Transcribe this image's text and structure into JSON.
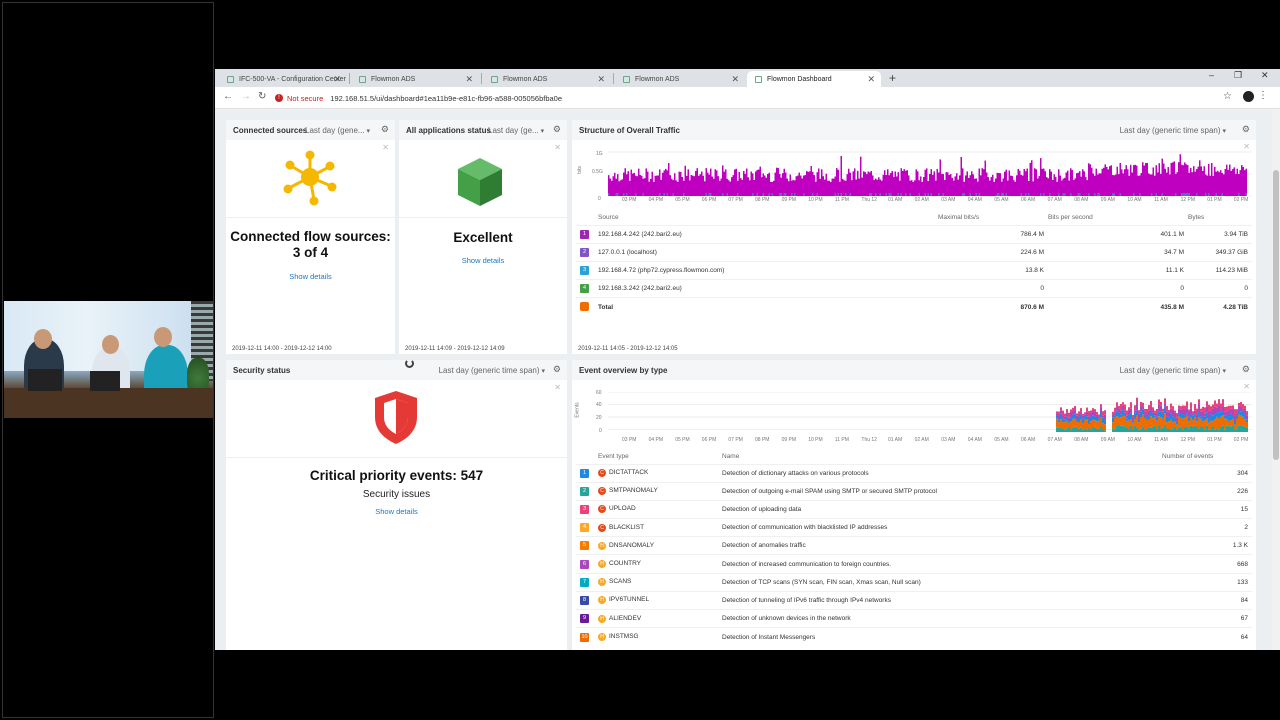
{
  "browser": {
    "tabs": [
      {
        "label": "IFC-500-VA - Configuration Center"
      },
      {
        "label": "Flowmon ADS"
      },
      {
        "label": "Flowmon ADS"
      },
      {
        "label": "Flowmon ADS"
      },
      {
        "label": "Flowmon Dashboard"
      }
    ],
    "new_tab": "+",
    "minimize": "–",
    "maximize": "❐",
    "close": "✕",
    "not_secure": "Not secure",
    "url": "192.168.51.5/ui/dashboard#1ea11b9e-e81c-fb96-a588-005056bfba0e"
  },
  "widgets": {
    "connected_sources": {
      "title": "Connected sources",
      "span": "Last day (gene...",
      "main": "Connected flow sources: 3 of 4",
      "link": "Show details",
      "footer": "2019-12-11 14:00 - 2019-12-12 14:00"
    },
    "app_status": {
      "title": "All applications status",
      "span": "Last day (ge...",
      "main": "Excellent",
      "link": "Show details",
      "footer": "2019-12-11 14:09 - 2019-12-12 14:09"
    },
    "security": {
      "title": "Security status",
      "span": "Last day (generic time span)",
      "main": "Critical priority events: 547",
      "sub": "Security issues",
      "link": "Show details"
    },
    "traffic": {
      "title": "Structure of Overall Traffic",
      "span": "Last day (generic time span)",
      "ylabel": "bits",
      "yticks": [
        "1G",
        "0.5G",
        "0"
      ],
      "xticks": [
        "03 PM",
        "04 PM",
        "05 PM",
        "06 PM",
        "07 PM",
        "08 PM",
        "09 PM",
        "10 PM",
        "11 PM",
        "Thu 12",
        "01 AM",
        "02 AM",
        "03 AM",
        "04 AM",
        "05 AM",
        "06 AM",
        "07 AM",
        "08 AM",
        "09 AM",
        "10 AM",
        "11 AM",
        "12 PM",
        "01 PM",
        "02 PM"
      ],
      "columns": [
        "Source",
        "Maximal bits/s",
        "Bits per second",
        "Bytes"
      ],
      "rows": [
        {
          "rank": "1",
          "color": "#9c27b0",
          "source": "192.168.4.242 (242.bari2.eu)",
          "max": "786.4 M",
          "bps": "401.1 M",
          "bytes": "3.94 TiB"
        },
        {
          "rank": "2",
          "color": "#7e57c2",
          "source": "127.0.0.1 (localhost)",
          "max": "224.6 M",
          "bps": "34.7 M",
          "bytes": "349.37 GiB"
        },
        {
          "rank": "3",
          "color": "#29a3d6",
          "source": "192.168.4.72 (php72.cypress.flowmon.com)",
          "max": "13.8 K",
          "bps": "11.1 K",
          "bytes": "114.23 MiB"
        },
        {
          "rank": "4",
          "color": "#43a047",
          "source": "192.168.3.242 (242.bari2.eu)",
          "max": "0",
          "bps": "0",
          "bytes": "0"
        }
      ],
      "total": {
        "label": "Total",
        "max": "870.6 M",
        "bps": "435.8 M",
        "bytes": "4.28 TiB"
      },
      "footer": "2019-12-11 14:05 - 2019-12-12 14:05"
    },
    "events": {
      "title": "Event overview by type",
      "span": "Last day (generic time span)",
      "ylabel": "Events",
      "yticks": [
        "60",
        "40",
        "20",
        "0"
      ],
      "columns": [
        "Event type",
        "Name",
        "Number of events"
      ],
      "rows": [
        {
          "rank": "1",
          "color": "#1e88e5",
          "sev": "C",
          "sevcolor": "#e64a19",
          "type": "DICTATTACK",
          "name": "Detection of dictionary attacks on various protocols",
          "count": "304"
        },
        {
          "rank": "2",
          "color": "#26a69a",
          "sev": "C",
          "sevcolor": "#e64a19",
          "type": "SMTPANOMALY",
          "name": "Detection of outgoing e-mail SPAM using SMTP or secured SMTP protocol",
          "count": "226"
        },
        {
          "rank": "3",
          "color": "#ec407a",
          "sev": "C",
          "sevcolor": "#e64a19",
          "type": "UPLOAD",
          "name": "Detection of uploading data",
          "count": "15"
        },
        {
          "rank": "4",
          "color": "#ffa726",
          "sev": "C",
          "sevcolor": "#e64a19",
          "type": "BLACKLIST",
          "name": "Detection of communication with blacklisted IP addresses",
          "count": "2"
        },
        {
          "rank": "5",
          "color": "#f57c00",
          "sev": "H",
          "sevcolor": "#f9a825",
          "type": "DNSANOMALY",
          "name": "Detection of anomalies traffic",
          "count": "1.3 K"
        },
        {
          "rank": "6",
          "color": "#ab47bc",
          "sev": "H",
          "sevcolor": "#f9a825",
          "type": "COUNTRY",
          "name": "Detection of increased communication to foreign countries.",
          "count": "668"
        },
        {
          "rank": "7",
          "color": "#00acc1",
          "sev": "H",
          "sevcolor": "#f9a825",
          "type": "SCANS",
          "name": "Detection of TCP scans (SYN scan, FIN scan, Xmas scan, Null scan)",
          "count": "133"
        },
        {
          "rank": "8",
          "color": "#3949ab",
          "sev": "H",
          "sevcolor": "#f9a825",
          "type": "IPV6TUNNEL",
          "name": "Detection of tunneling of IPv6 traffic through IPv4 networks",
          "count": "84"
        },
        {
          "rank": "9",
          "color": "#6a1b9a",
          "sev": "H",
          "sevcolor": "#f9a825",
          "type": "ALIENDEV",
          "name": "Detection of unknown devices in the network",
          "count": "67"
        },
        {
          "rank": "10",
          "color": "#ef6c00",
          "sev": "H",
          "sevcolor": "#f9a825",
          "type": "INSTMSG",
          "name": "Detection of Instant Messengers",
          "count": "64"
        }
      ]
    }
  },
  "colors": {
    "accent_link": "#1d76c9",
    "traffic_magenta": "#c000c0",
    "app_green": "#43a047",
    "shield_red": "#e53935",
    "source_yellow": "#f5b800"
  }
}
